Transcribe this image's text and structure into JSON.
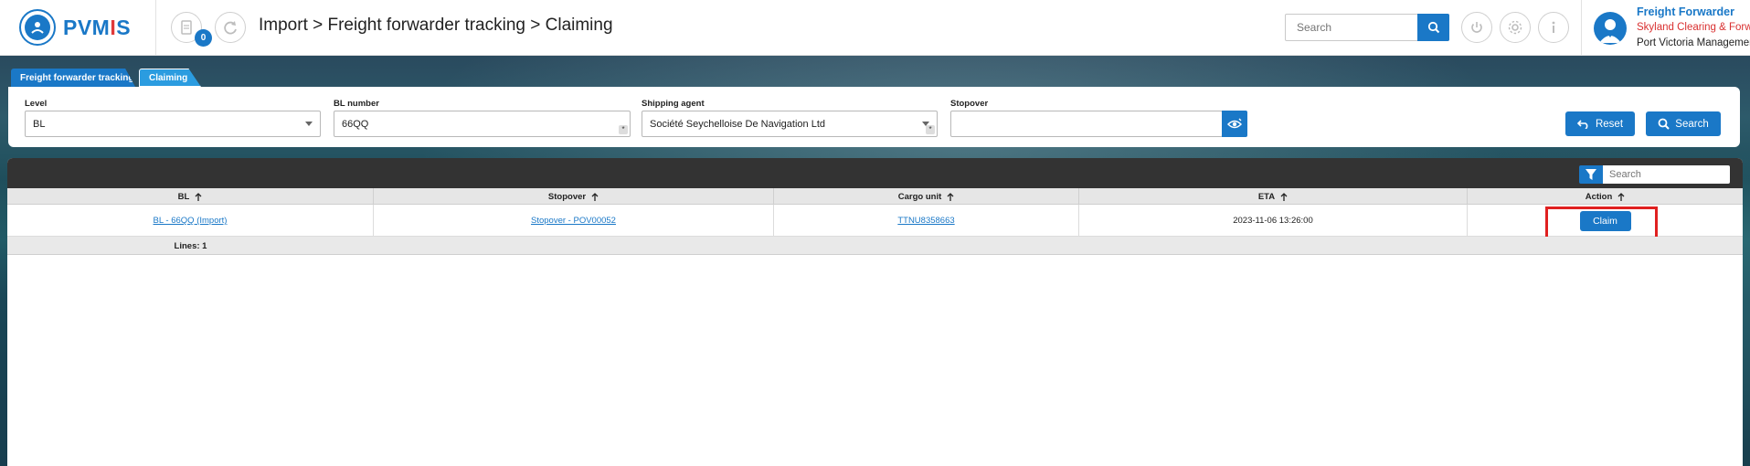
{
  "app": {
    "logo_prefix": "PVM",
    "logo_accent": "I",
    "logo_suffix": "S"
  },
  "header": {
    "notification_count": "0",
    "breadcrumb": "Import > Freight forwarder tracking > Claiming",
    "search_placeholder": "Search",
    "icons": [
      "document-icon",
      "refresh-icon",
      "search-icon",
      "power-icon",
      "settings-icon",
      "info-icon"
    ]
  },
  "user": {
    "role": "Freight Forwarder",
    "company": "Skyland Clearing & Forwarding",
    "organization": "Port Victoria Management"
  },
  "tabs": [
    {
      "label": "Freight forwarder tracking"
    },
    {
      "label": "Claiming"
    }
  ],
  "filters": {
    "level": {
      "label": "Level",
      "value": "BL"
    },
    "bl_number": {
      "label": "BL number",
      "value": "66QQ"
    },
    "shipping_agent": {
      "label": "Shipping agent",
      "value": "Société Seychelloise De Navigation Ltd"
    },
    "stopover": {
      "label": "Stopover",
      "value": ""
    },
    "reset_label": "Reset",
    "search_label": "Search"
  },
  "grid": {
    "search_placeholder": "Search",
    "columns": [
      "BL",
      "Stopover",
      "Cargo unit",
      "ETA",
      "Action"
    ],
    "rows": [
      {
        "bl": "BL - 66QQ (Import)",
        "stopover": "Stopover - POV00052",
        "cargo_unit": "TTNU8358663",
        "eta": "2023-11-06 13:26:00",
        "action": "Claim"
      }
    ],
    "lines_text": "Lines: 1"
  },
  "colors": {
    "primary": "#1a78c7",
    "accent_red": "#e03a3a",
    "highlight": "#e02020",
    "toolbar_dark": "#333333"
  }
}
